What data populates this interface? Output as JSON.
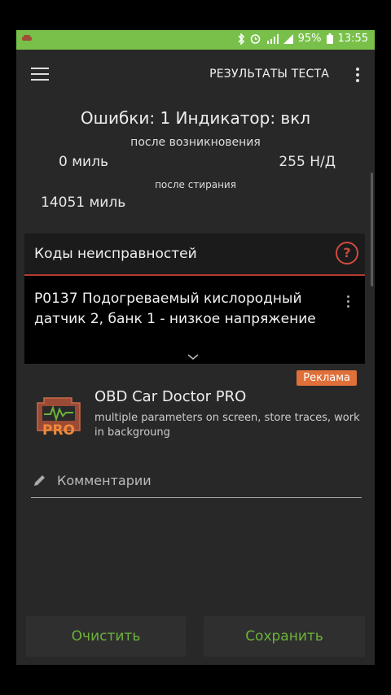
{
  "status": {
    "battery": "95%",
    "time": "13:55"
  },
  "appbar": {
    "title": "РЕЗУЛЬТАТЫ ТЕСТА"
  },
  "summary": {
    "errors_line": "Ошибки: 1 Индикатор: вкл",
    "after_occurrence": "после возникновения",
    "miles_since": "0 миль",
    "nd_value": "255 Н/Д",
    "after_clear": "после стирания",
    "miles_total": "14051 миль"
  },
  "codes": {
    "title": "Коды неисправностей",
    "items": [
      {
        "text": "P0137 Подогреваемый кислородный датчик 2, банк 1 - низкое напряжение"
      }
    ]
  },
  "ad": {
    "badge": "Реклама",
    "title": "OBD Car Doctor PRO",
    "description": "multiple parameters on screen, store traces, work in backgroung",
    "logo_text": "PRO"
  },
  "comment": {
    "placeholder": "Комментарии"
  },
  "buttons": {
    "clear": "Очистить",
    "save": "Сохранить"
  },
  "colors": {
    "status_bar": "#78c04a",
    "accent_green": "#6db23b",
    "accent_red": "#d04a3e",
    "ad_badge": "#e0703a"
  }
}
